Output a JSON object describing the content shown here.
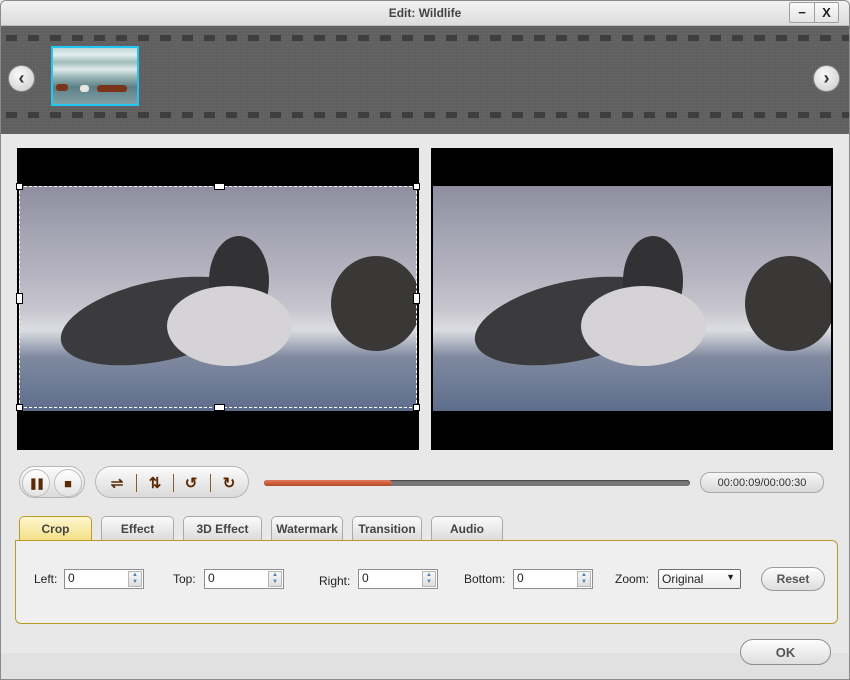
{
  "window": {
    "title": "Edit: Wildlife",
    "minimize_label": "−",
    "close_label": "X"
  },
  "filmstrip": {
    "prev_icon": "‹",
    "next_icon": "›",
    "clips": [
      {
        "name": "Wildlife",
        "selected": true,
        "accent": "#23c6f0"
      }
    ]
  },
  "playback": {
    "pause_icon": "❚❚",
    "stop_icon": "■",
    "flip_horizontal_icon": "⇌",
    "flip_vertical_icon": "⇅",
    "rotate_left_icon": "↺",
    "rotate_right_icon": "↻",
    "progress_fraction": 0.3,
    "progress_color": "#c4553a",
    "time": "00:00:09/00:00:30"
  },
  "tabs": [
    {
      "label": "Crop",
      "active": true
    },
    {
      "label": "Effect",
      "active": false
    },
    {
      "label": "3D Effect",
      "active": false
    },
    {
      "label": "Watermark",
      "active": false
    },
    {
      "label": "Transition",
      "active": false
    },
    {
      "label": "Audio",
      "active": false
    }
  ],
  "crop": {
    "left_label": "Left:",
    "left_value": "0",
    "top_label": "Top:",
    "top_value": "0",
    "right_label": "Right:",
    "right_value": "0",
    "bottom_label": "Bottom:",
    "bottom_value": "0",
    "zoom_label": "Zoom:",
    "zoom_value": "Original",
    "reset_label": "Reset"
  },
  "footer": {
    "ok_label": "OK"
  },
  "colors": {
    "active_tab_border": "#b89c2a",
    "thumb_highlight": "#23c6f0"
  }
}
